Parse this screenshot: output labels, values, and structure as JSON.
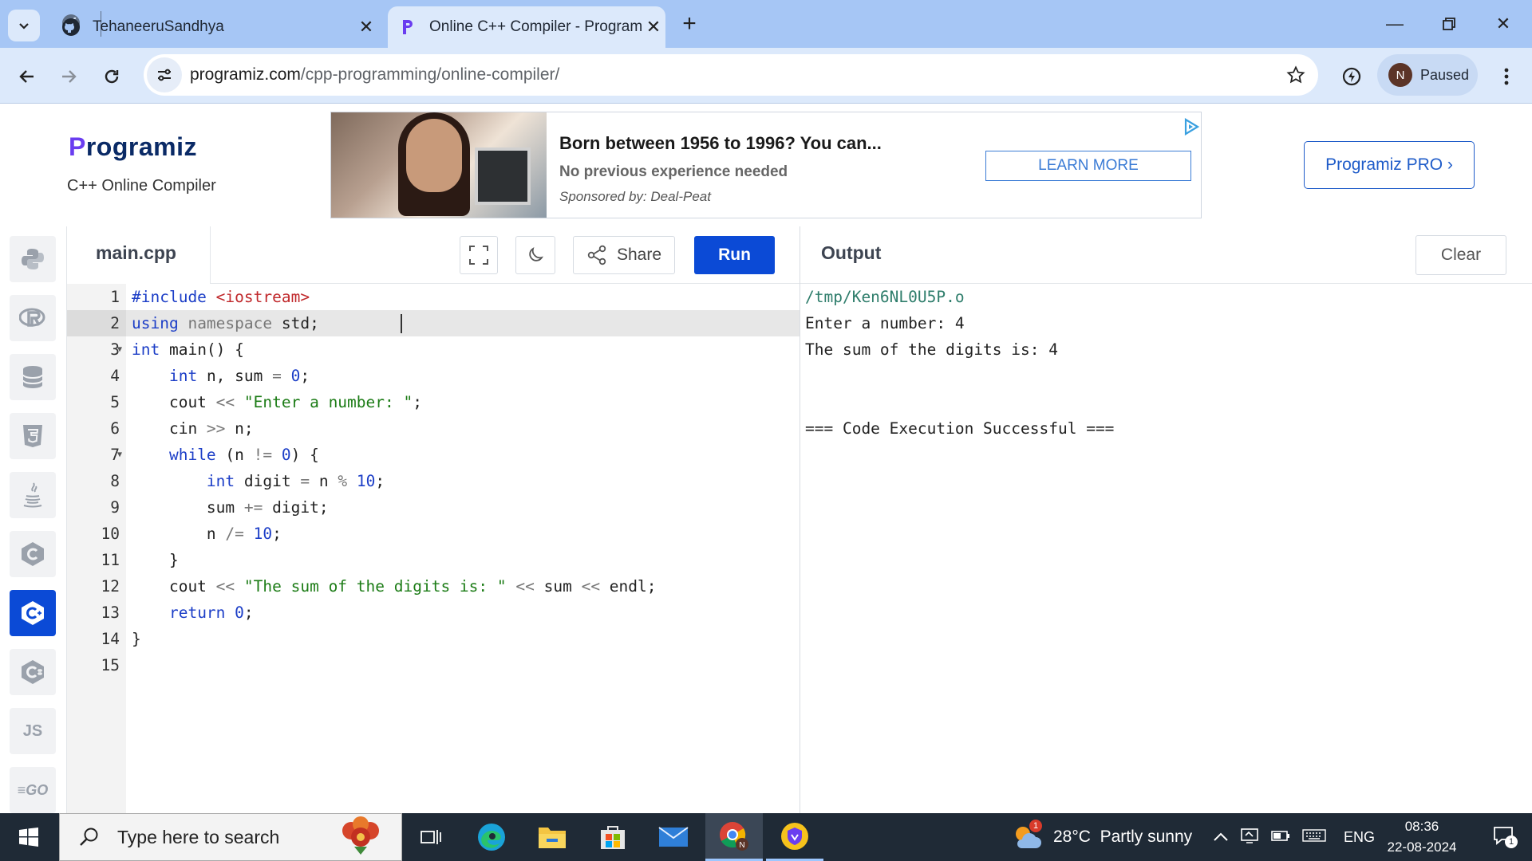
{
  "browser": {
    "tabs": [
      {
        "title": "TehaneeruSandhya",
        "active": false
      },
      {
        "title": "Online C++ Compiler - Programiz",
        "active": true
      }
    ],
    "url_host": "programiz.com",
    "url_path": "/cpp-programming/online-compiler/",
    "profile_initial": "N",
    "profile_status": "Paused"
  },
  "site": {
    "logo_text": "rogramiz",
    "logo_initial": "P",
    "subtitle": "C++ Online Compiler",
    "pro_button": "Programiz PRO ›"
  },
  "ad": {
    "headline": "Born between 1956 to 1996? You can...",
    "subline": "No previous experience needed",
    "sponsor": "Sponsored by: Deal-Peat",
    "cta": "LEARN MORE"
  },
  "rail": {
    "items": [
      "python-icon",
      "r-icon",
      "sql-icon",
      "html5-icon",
      "java-icon",
      "c-icon",
      "cpp-icon",
      "csharp-icon",
      "js-icon",
      "go-icon"
    ],
    "js_label": "JS",
    "go_label": "GO"
  },
  "editor": {
    "filename": "main.cpp",
    "share_label": "Share",
    "run_label": "Run",
    "line_numbers": [
      "1",
      "2",
      "3",
      "4",
      "5",
      "6",
      "7",
      "8",
      "9",
      "10",
      "11",
      "12",
      "13",
      "14",
      "15"
    ],
    "code_lines": [
      "#include <iostream>",
      "using namespace std;",
      "int main() {",
      "    int n, sum = 0;",
      "    cout << \"Enter a number: \";",
      "    cin >> n;",
      "    while (n != 0) {",
      "        int digit = n % 10;",
      "        sum += digit;",
      "        n /= 10;",
      "    }",
      "    cout << \"The sum of the digits is: \" << sum << endl;",
      "    return 0;",
      "}",
      ""
    ]
  },
  "output": {
    "label": "Output",
    "clear_label": "Clear",
    "lines": [
      "/tmp/Ken6NL0U5P.o",
      "Enter a number: 4",
      "The sum of the digits is: 4",
      "",
      "",
      "=== Code Execution Successful ==="
    ]
  },
  "taskbar": {
    "search_placeholder": "Type here to search",
    "weather_badge": "1",
    "weather": "28°C  Partly sunny",
    "language": "ENG",
    "time": "08:36",
    "date": "22-08-2024",
    "notification_count": "1"
  },
  "colors": {
    "accent": "#0b4ad6",
    "tab_strip": "#a6c6f5",
    "toolbar": "#dce9fb",
    "keyword": "#1c3ec7",
    "string": "#1c7c16",
    "preprocessor": "#c0282b"
  }
}
